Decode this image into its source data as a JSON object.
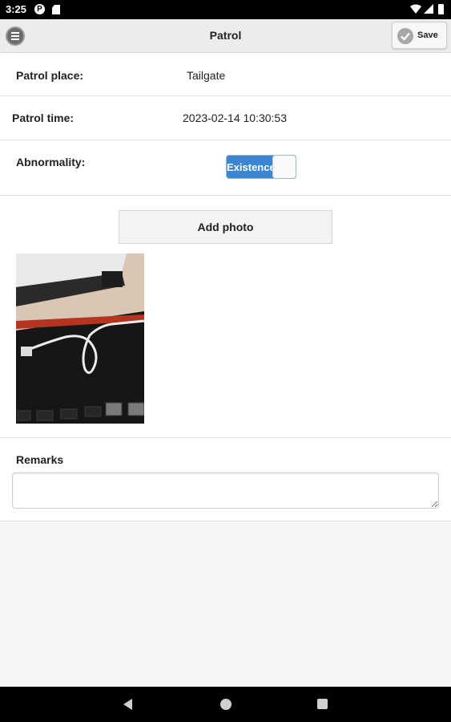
{
  "status_bar": {
    "time": "3:25",
    "notification_icon": "P"
  },
  "app_bar": {
    "title": "Patrol",
    "save_label": "Save"
  },
  "form": {
    "patrol_place": {
      "label": "Patrol place:",
      "value": "Tailgate"
    },
    "patrol_time": {
      "label": "Patrol time:",
      "value": "2023-02-14 10:30:53"
    },
    "abnormality": {
      "label": "Abnormality:",
      "toggle_text": "Existence",
      "on": true
    },
    "add_photo_label": "Add photo",
    "remarks": {
      "label": "Remarks",
      "value": "",
      "placeholder": ""
    }
  },
  "colors": {
    "toggle_on": "#3a86d3",
    "app_bar_bg": "#ececec",
    "page_bg": "#f5f5f5"
  },
  "icons": [
    "menu-icon",
    "check-icon",
    "wifi-icon",
    "signal-icon",
    "battery-icon",
    "back-icon",
    "home-icon",
    "recents-icon"
  ]
}
